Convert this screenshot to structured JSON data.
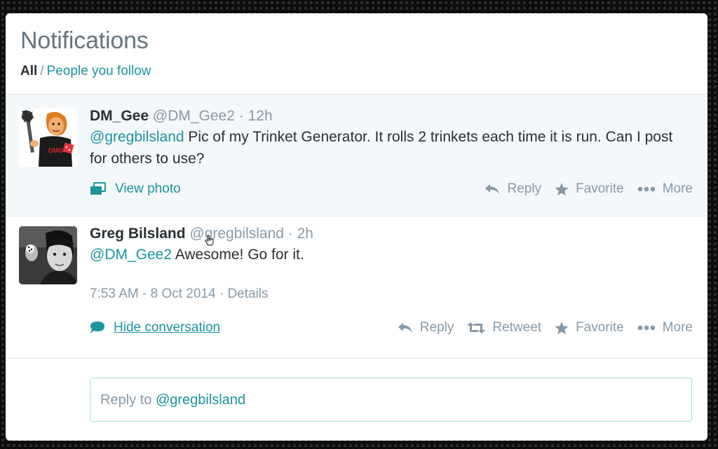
{
  "header": {
    "title": "Notifications",
    "filter_all": "All",
    "filter_separator": "/",
    "filter_following": "People you follow"
  },
  "tweets": [
    {
      "name": "DM_Gee",
      "handle": "@DM_Gee2",
      "dot": "·",
      "time": "12h",
      "mention": "@gregbilsland",
      "text": " Pic of my Trinket Generator. It rolls 2 trinkets each time it is run. Can I post for others to use?",
      "media_link": "View photo",
      "actions": [
        "Reply",
        "Favorite",
        "More"
      ]
    },
    {
      "name": "Greg Bilsland",
      "handle": "@gregbilsland",
      "dot": "·",
      "time": "2h",
      "mention": "@DM_Gee2",
      "text": " Awesome! Go for it.",
      "timestamp": "7:53 AM - 8 Oct 2014",
      "details_sep": " · ",
      "details": "Details",
      "conversation_link": "Hide conversation",
      "actions": [
        "Reply",
        "Retweet",
        "Favorite",
        "More"
      ]
    }
  ],
  "reply_box": {
    "prefix": "Reply to ",
    "mention": "@gregbilsland"
  },
  "icons": {
    "photo": "photo-icon",
    "reply": "reply-icon",
    "retweet": "retweet-icon",
    "favorite": "star-icon",
    "more": "more-dots-icon",
    "conversation": "speech-bubble-icon"
  },
  "colors": {
    "link": "#1b95a0",
    "muted": "#8899a6",
    "text": "#292f33",
    "highlight_bg": "#f5f8fa"
  }
}
